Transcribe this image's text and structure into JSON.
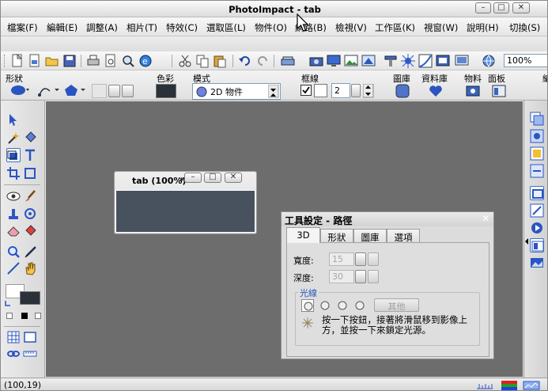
{
  "window": {
    "title": "PhotoImpact - tab"
  },
  "menu": [
    "檔案(F)",
    "編輯(E)",
    "調整(A)",
    "相片(T)",
    "特效(C)",
    "選取區(L)",
    "物件(O)",
    "網路(B)",
    "檢視(V)",
    "工作區(K)",
    "視窗(W)",
    "說明(H)",
    "切換(S)"
  ],
  "toolbar": {
    "zoom_value": "100%"
  },
  "attributes": {
    "shape_label": "形狀",
    "color_label": "色彩",
    "mode_label": "模式",
    "mode_value": "2D 物件",
    "border_label": "框線",
    "border_checked": true,
    "border_width": "2",
    "frame_label": "圖庫",
    "library_label": "資料庫",
    "material_label": "物料",
    "panel_label": "面板",
    "last_label": "編"
  },
  "document": {
    "title": "tab (100%)",
    "title_suffix": "*"
  },
  "tool_settings": {
    "title": "工具設定 - 路徑",
    "tabs": [
      "3D",
      "形狀",
      "圖庫",
      "選項"
    ],
    "width_label": "寬度:",
    "width_value": "15",
    "depth_label": "深度:",
    "depth_value": "30",
    "light_label": "光線",
    "other_button": "其他",
    "hint": "按一下按鈕，接著將滑鼠移到影像上方，並按一下來鎖定光源。"
  },
  "status": {
    "coords": "(100,19)"
  },
  "colors": {
    "workspace": "#6d6d6d",
    "canvas": "#48525e",
    "accent": "#3a6fc8",
    "shape_fill": "#2a55c0"
  }
}
